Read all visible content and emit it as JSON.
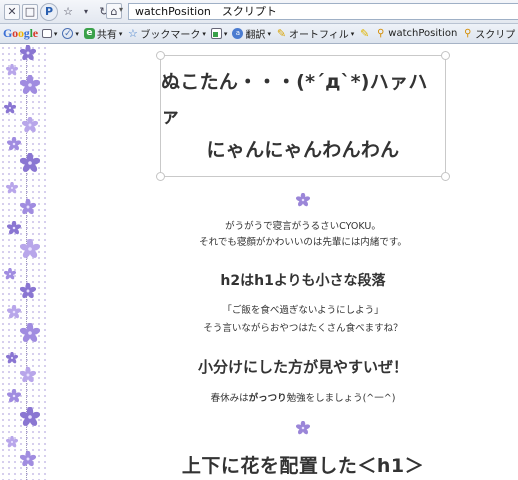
{
  "browser": {
    "url": "watchPosition　スクリプト",
    "nav_icons": [
      "stop-icon",
      "page-icon",
      "logo-icon",
      "star-icon",
      "dropdown-icon",
      "refresh-icon",
      "home-icon"
    ]
  },
  "toolbar": {
    "logo": [
      "G",
      "o",
      "o",
      "g",
      "l",
      "e"
    ],
    "items": [
      {
        "label": "",
        "icon": "search-box-icon"
      },
      {
        "label": "",
        "icon": "check-icon"
      },
      {
        "label": "共有",
        "icon": "share-icon"
      },
      {
        "label": "ブックマーク",
        "icon": "star-icon"
      },
      {
        "label": "",
        "icon": "translate-icon"
      },
      {
        "label": "翻訳",
        "icon": "translate-icon"
      },
      {
        "label": "オートフィル",
        "icon": "pencil-icon"
      },
      {
        "label": "",
        "icon": "pencil-icon"
      },
      {
        "label": "watchPosition",
        "icon": "search-icon"
      },
      {
        "label": "スクリプト",
        "icon": "search-icon"
      }
    ]
  },
  "content": {
    "h1_line1": "ぬこたん・・・(*´д`*)ハァハァ",
    "h1_line2": "にゃんにゃんわんわん",
    "p1_line1": "がうがうで寝言がうるさいCYOKU。",
    "p1_line2": "それでも寝顔がかわいいのは先輩には内緒です。",
    "h2_1": "h2はh1よりも小さな段落",
    "p2_line1": "「ご飯を食べ過ぎないようにしよう」",
    "p2_line2": "そう言いながらおやつはたくさん食べますね？",
    "h2_2": "小分けにした方が見やすいぜ！",
    "p3_before": "春休みは",
    "p3_bold": "がっつり",
    "p3_after": "勉強をしましょう(^一^)",
    "h1_bottom": "上下に花を配置した＜h1＞"
  },
  "colors": {
    "flower": "#9b86d8",
    "flower_center": "#e8e0ff",
    "text": "#333333"
  }
}
